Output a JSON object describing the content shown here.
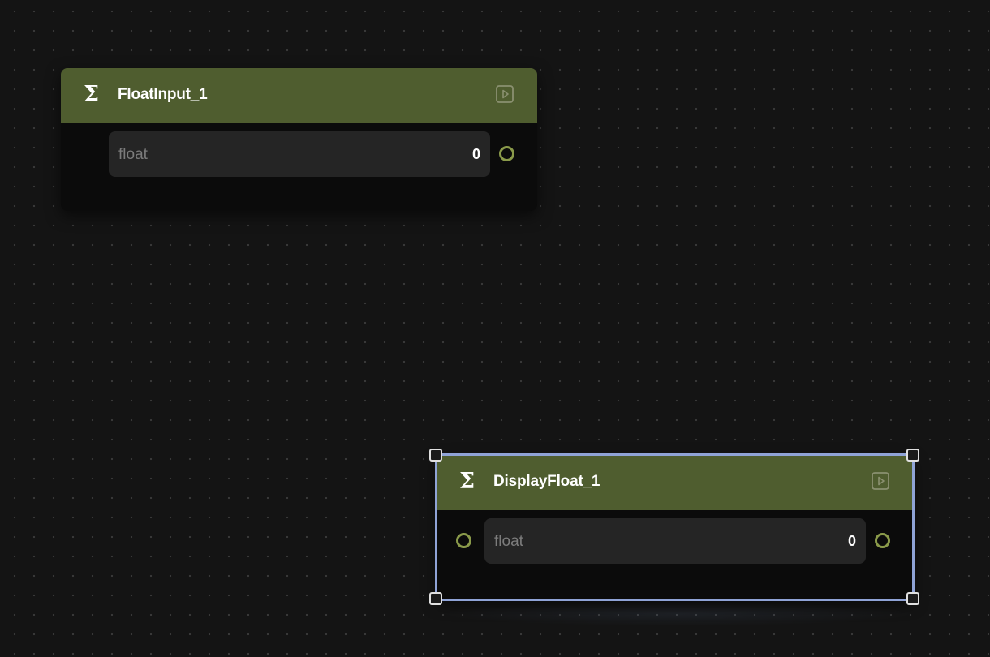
{
  "colors": {
    "canvas_bg": "#141414",
    "node_header": "#4f5d2f",
    "port_ring": "#8a9a4a",
    "selection": "#8fa3d6"
  },
  "nodes": [
    {
      "id": "float-input",
      "title": "FloatInput_1",
      "icon": "sigma-icon",
      "action_icon": "run-icon",
      "selected": false,
      "field": {
        "label": "float",
        "value": "0"
      },
      "ports": [
        "output"
      ]
    },
    {
      "id": "display-float",
      "title": "DisplayFloat_1",
      "icon": "sigma-icon",
      "action_icon": "run-icon",
      "selected": true,
      "field": {
        "label": "float",
        "value": "0"
      },
      "ports": [
        "input",
        "output"
      ]
    }
  ]
}
